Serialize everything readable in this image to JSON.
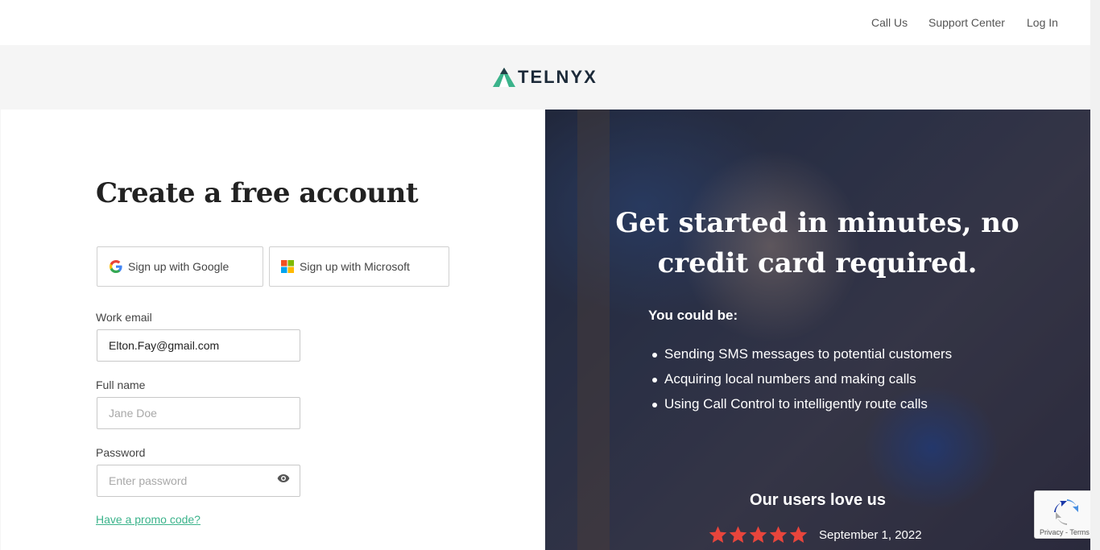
{
  "nav": {
    "call_us": "Call Us",
    "support_center": "Support Center",
    "log_in": "Log In"
  },
  "brand": {
    "logo_text": "TELNYX",
    "logo_color": "#3bb38b"
  },
  "form": {
    "title": "Create a free account",
    "google_button": "Sign up with Google",
    "microsoft_button": "Sign up with Microsoft",
    "email_label": "Work email",
    "email_value": "Elton.Fay@gmail.com",
    "fullname_label": "Full name",
    "fullname_placeholder": "Jane Doe",
    "password_label": "Password",
    "password_placeholder": "Enter password",
    "password_toggle_icon": "eye-icon",
    "promo_link": "Have a promo code?",
    "accent_color": "#3bb38b"
  },
  "hero": {
    "title": "Get started in minutes, no credit card required.",
    "subtitle": "You could be:",
    "items": [
      "Sending SMS messages to potential customers",
      "Acquiring local numbers and making calls",
      "Using Call Control to intelligently route calls"
    ],
    "users_love": "Our users love us",
    "rating": 5,
    "rating_max": 5,
    "star_color": "#e8453c",
    "review_date": "September 1, 2022"
  },
  "recaptcha": {
    "links": "Privacy - Terms"
  }
}
